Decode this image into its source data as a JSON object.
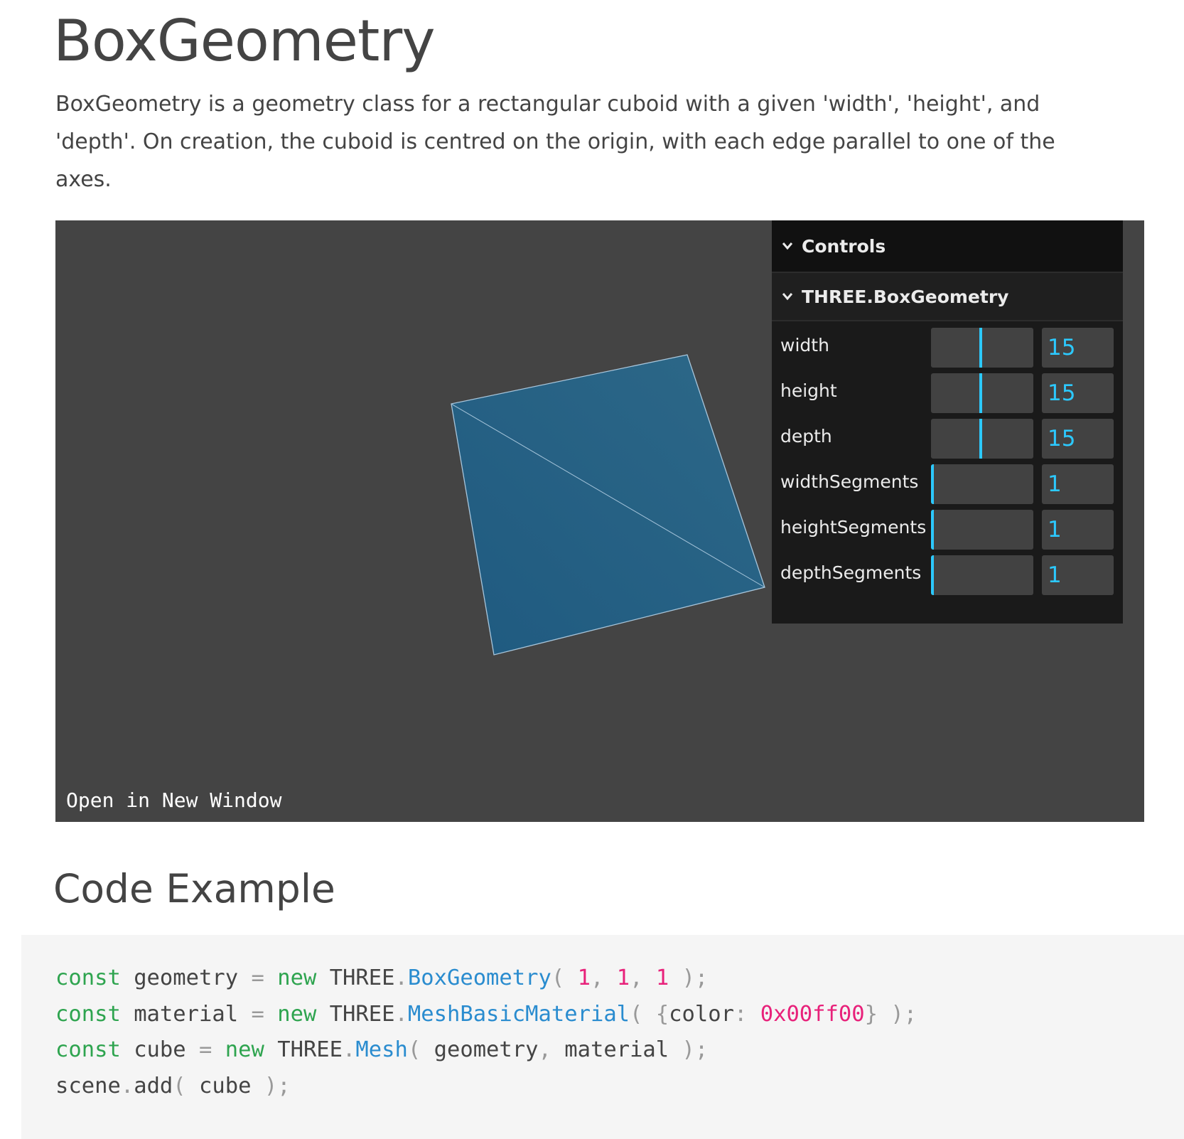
{
  "page": {
    "title": "BoxGeometry",
    "intro": "BoxGeometry is a geometry class for a rectangular cuboid with a given 'width', 'height', and 'depth'. On creation, the cuboid is centred on the origin, with each edge parallel to one of the axes."
  },
  "viewer": {
    "open_link": "Open in New Window",
    "background_color": "#444444",
    "mesh_color": "#22628a",
    "gui": {
      "root_title": "Controls",
      "folder_title": "THREE.BoxGeometry",
      "accent_color": "#2cc9ff",
      "rows": [
        {
          "name": "width",
          "label": "width",
          "value": "15",
          "fraction": 0.47
        },
        {
          "name": "height",
          "label": "height",
          "value": "15",
          "fraction": 0.47
        },
        {
          "name": "depth",
          "label": "depth",
          "value": "15",
          "fraction": 0.47
        },
        {
          "name": "widthsegments",
          "label": "widthSegments",
          "value": "1",
          "fraction": 0.0
        },
        {
          "name": "heightsegments",
          "label": "heightSegments",
          "value": "1",
          "fraction": 0.0
        },
        {
          "name": "depthsegments",
          "label": "depthSegments",
          "value": "1",
          "fraction": 0.0
        }
      ]
    }
  },
  "code_example": {
    "heading": "Code Example",
    "lines": [
      [
        {
          "t": "const",
          "k": "kw"
        },
        {
          "t": " geometry ",
          "k": "plain"
        },
        {
          "t": "=",
          "k": "punc"
        },
        {
          "t": " ",
          "k": "plain"
        },
        {
          "t": "new",
          "k": "kw"
        },
        {
          "t": " THREE",
          "k": "plain"
        },
        {
          "t": ".",
          "k": "punc"
        },
        {
          "t": "BoxGeometry",
          "k": "cls"
        },
        {
          "t": "( ",
          "k": "punc"
        },
        {
          "t": "1",
          "k": "num"
        },
        {
          "t": ", ",
          "k": "punc"
        },
        {
          "t": "1",
          "k": "num"
        },
        {
          "t": ", ",
          "k": "punc"
        },
        {
          "t": "1",
          "k": "num"
        },
        {
          "t": " );",
          "k": "punc"
        }
      ],
      [
        {
          "t": "const",
          "k": "kw"
        },
        {
          "t": " material ",
          "k": "plain"
        },
        {
          "t": "=",
          "k": "punc"
        },
        {
          "t": " ",
          "k": "plain"
        },
        {
          "t": "new",
          "k": "kw"
        },
        {
          "t": " THREE",
          "k": "plain"
        },
        {
          "t": ".",
          "k": "punc"
        },
        {
          "t": "MeshBasicMaterial",
          "k": "cls"
        },
        {
          "t": "( ",
          "k": "punc"
        },
        {
          "t": "{",
          "k": "punc"
        },
        {
          "t": "color",
          "k": "plain"
        },
        {
          "t": ": ",
          "k": "punc"
        },
        {
          "t": "0x00ff00",
          "k": "num"
        },
        {
          "t": "}",
          "k": "punc"
        },
        {
          "t": " );",
          "k": "punc"
        }
      ],
      [
        {
          "t": "const",
          "k": "kw"
        },
        {
          "t": " cube ",
          "k": "plain"
        },
        {
          "t": "=",
          "k": "punc"
        },
        {
          "t": " ",
          "k": "plain"
        },
        {
          "t": "new",
          "k": "kw"
        },
        {
          "t": " THREE",
          "k": "plain"
        },
        {
          "t": ".",
          "k": "punc"
        },
        {
          "t": "Mesh",
          "k": "cls"
        },
        {
          "t": "( ",
          "k": "punc"
        },
        {
          "t": "geometry",
          "k": "plain"
        },
        {
          "t": ", ",
          "k": "punc"
        },
        {
          "t": "material",
          "k": "plain"
        },
        {
          "t": " );",
          "k": "punc"
        }
      ],
      [
        {
          "t": "scene",
          "k": "plain"
        },
        {
          "t": ".",
          "k": "punc"
        },
        {
          "t": "add",
          "k": "plain"
        },
        {
          "t": "( ",
          "k": "punc"
        },
        {
          "t": "cube",
          "k": "plain"
        },
        {
          "t": " );",
          "k": "punc"
        }
      ]
    ]
  }
}
